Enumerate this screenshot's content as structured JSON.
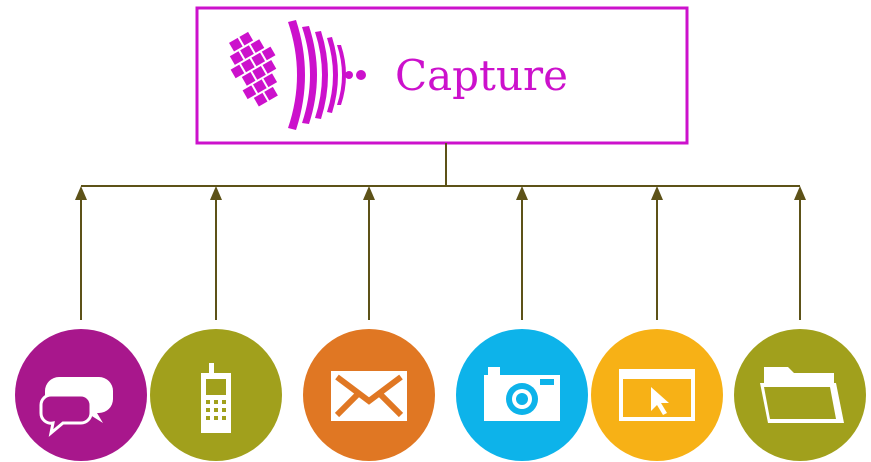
{
  "capture_box": {
    "title": "Capture",
    "accent_color": "#cc11cc",
    "logo_icon": "capture-logo-icon"
  },
  "connector_color": "#5d5218",
  "sources": [
    {
      "name": "chat",
      "icon": "speech-bubbles-icon",
      "color": "#a8178c"
    },
    {
      "name": "mobile",
      "icon": "mobile-phone-icon",
      "color": "#a1a01c"
    },
    {
      "name": "email",
      "icon": "envelope-icon",
      "color": "#e07723"
    },
    {
      "name": "photo",
      "icon": "camera-icon",
      "color": "#0db3ea"
    },
    {
      "name": "web",
      "icon": "browser-window-icon",
      "color": "#f7b116"
    },
    {
      "name": "files",
      "icon": "folder-icon",
      "color": "#a1a01c"
    }
  ]
}
